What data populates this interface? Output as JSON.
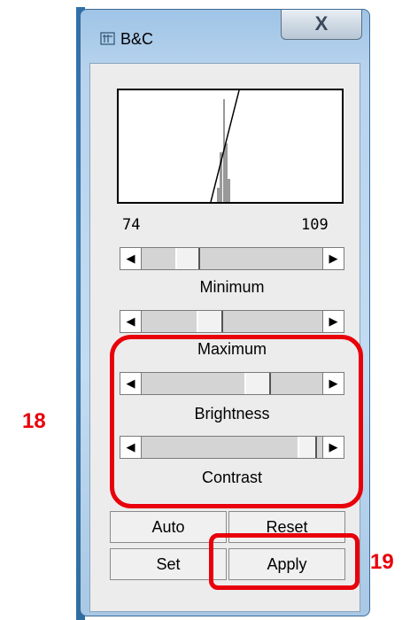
{
  "window": {
    "title": "B&C",
    "close_glyph": "X"
  },
  "histogram": {
    "min_label": "74",
    "max_label": "109"
  },
  "sliders": [
    {
      "label": "Minimum",
      "position": 0.35
    },
    {
      "label": "Maximum",
      "position": 0.44
    },
    {
      "label": "Brightness",
      "position": 0.62
    },
    {
      "label": "Contrast",
      "position": 0.92
    }
  ],
  "buttons": {
    "auto": "Auto",
    "reset": "Reset",
    "set": "Set",
    "apply": "Apply"
  },
  "annotations": {
    "group_number": "18",
    "apply_number": "19",
    "color": "#e8000b"
  }
}
